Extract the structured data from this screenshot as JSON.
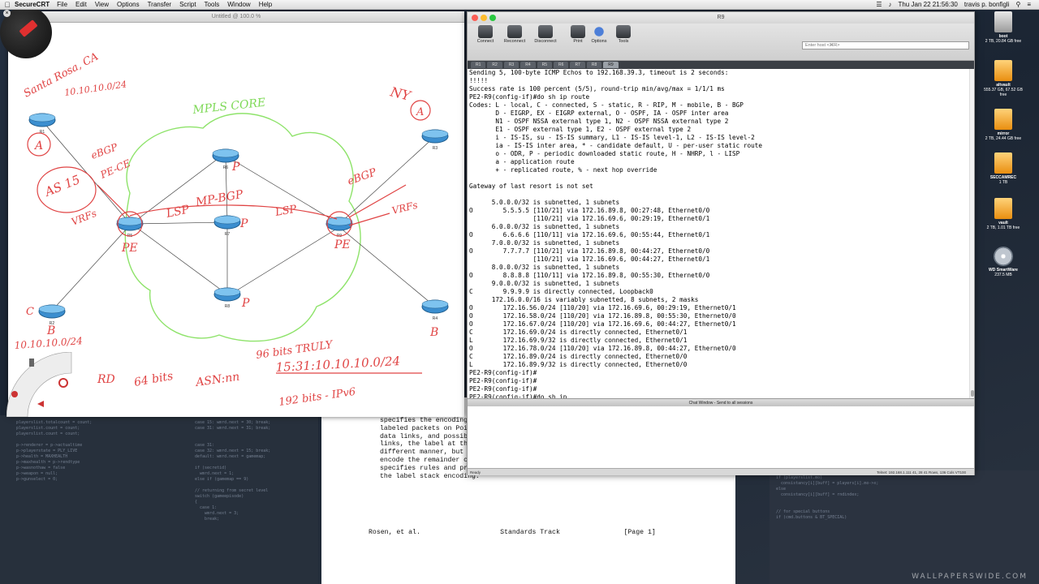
{
  "menubar": {
    "app_name": "SecureCRT",
    "items": [
      "File",
      "Edit",
      "View",
      "Options",
      "Transfer",
      "Script",
      "Tools",
      "Window",
      "Help"
    ],
    "clock": "Thu Jan 22  21:56:30",
    "user": "travis p. bonfigli"
  },
  "desktop": {
    "drives": [
      {
        "name": "boot",
        "size": "2 TB, 20.84 GB free",
        "icon": "hard-drive-icon"
      },
      {
        "name": "altvault",
        "size": "555.37 GB, 67.52 GB free",
        "icon": "hard-drive-icon"
      },
      {
        "name": "mirror",
        "size": "2 TB, 24.44 GB free",
        "icon": "hard-drive-icon"
      },
      {
        "name": "SECCAMREC",
        "size": "1 TB",
        "icon": "hard-drive-icon"
      },
      {
        "name": "vault",
        "size": "2 TB, 1.01 TB free",
        "icon": "hard-drive-icon"
      },
      {
        "name": "WD SmartWare",
        "size": "237.5 MB",
        "icon": "disc-icon"
      }
    ],
    "watermark": "WALLPAPERSWIDE.COM"
  },
  "whiteboard": {
    "title": "Untitled @ 100.0 %",
    "routers": [
      {
        "label": "R1"
      },
      {
        "label": "R2"
      },
      {
        "label": "R3"
      },
      {
        "label": "R4"
      },
      {
        "label": "R5"
      },
      {
        "label": "R6"
      },
      {
        "label": "R7"
      },
      {
        "label": "R8"
      },
      {
        "label": "R9"
      }
    ],
    "annotations": {
      "site_a": "Santa Rosa, CA",
      "prefix_a": "10.10.10.0/24",
      "mark_a": "A",
      "ebgp_left": "eBGP",
      "pe_ce": "PE-CE",
      "as": "AS 15",
      "vrfs_left": "VRFs",
      "pe_left": "PE",
      "mpls_core": "MPLS CORE",
      "lsp_left": "LSP",
      "mp_bgp": "MP-BGP",
      "lsp_right": "LSP",
      "p_top": "P",
      "p_mid": "P",
      "p_bottom": "P",
      "site_ny": "NY",
      "mark_a_right": "A",
      "ebgp_right": "eBGP",
      "vrfs_right": "VRFs",
      "pe_right": "PE",
      "mark_b_left": "B",
      "prefix_b": "10.10.10.0/24",
      "mark_c": "C",
      "mark_b_right": "B",
      "rd": "RD",
      "bits_64": "64 bits",
      "asn": "ASN:nn",
      "bits_96": "96 bits TRULY",
      "rd_example": "15:31:10.10.10.0/24",
      "ipv6": "192 bits - IPv6"
    }
  },
  "crt": {
    "window_title": "R9",
    "toolbar": [
      {
        "label": "Connect",
        "icon": "connect-icon"
      },
      {
        "label": "Reconnect",
        "icon": "reconnect-icon"
      },
      {
        "label": "Disconnect",
        "icon": "disconnect-icon"
      },
      {
        "label": "Print",
        "icon": "print-icon"
      },
      {
        "label": "Options",
        "icon": "options-icon"
      },
      {
        "label": "Tools",
        "icon": "tools-icon"
      }
    ],
    "host_placeholder": "Enter host <⌘R>",
    "tabs": [
      "R1",
      "R2",
      "R3",
      "R4",
      "R5",
      "R6",
      "R7",
      "R8",
      "R9"
    ],
    "active_tab": "R9",
    "terminal_lines": [
      "Sending 5, 100-byte ICMP Echos to 192.168.39.3, timeout is 2 seconds:",
      "!!!!!",
      "Success rate is 100 percent (5/5), round-trip min/avg/max = 1/1/1 ms",
      "PE2-R9(config-if)#do sh ip route",
      "Codes: L - local, C - connected, S - static, R - RIP, M - mobile, B - BGP",
      "       D - EIGRP, EX - EIGRP external, O - OSPF, IA - OSPF inter area",
      "       N1 - OSPF NSSA external type 1, N2 - OSPF NSSA external type 2",
      "       E1 - OSPF external type 1, E2 - OSPF external type 2",
      "       i - IS-IS, su - IS-IS summary, L1 - IS-IS level-1, L2 - IS-IS level-2",
      "       ia - IS-IS inter area, * - candidate default, U - per-user static route",
      "       o - ODR, P - periodic downloaded static route, H - NHRP, l - LISP",
      "       a - application route",
      "       + - replicated route, % - next hop override",
      "",
      "Gateway of last resort is not set",
      "",
      "      5.0.0.0/32 is subnetted, 1 subnets",
      "O        5.5.5.5 [110/21] via 172.16.89.8, 00:27:48, Ethernet0/0",
      "                 [110/21] via 172.16.69.6, 00:29:19, Ethernet0/1",
      "      6.0.0.0/32 is subnetted, 1 subnets",
      "O        6.6.6.6 [110/11] via 172.16.69.6, 00:55:44, Ethernet0/1",
      "      7.0.0.0/32 is subnetted, 1 subnets",
      "O        7.7.7.7 [110/21] via 172.16.89.8, 00:44:27, Ethernet0/0",
      "                 [110/21] via 172.16.69.6, 00:44:27, Ethernet0/1",
      "      8.0.0.0/32 is subnetted, 1 subnets",
      "O        8.8.8.8 [110/11] via 172.16.89.8, 00:55:30, Ethernet0/0",
      "      9.0.0.0/32 is subnetted, 1 subnets",
      "C        9.9.9.9 is directly connected, Loopback0",
      "      172.16.0.0/16 is variably subnetted, 8 subnets, 2 masks",
      "O        172.16.56.0/24 [110/20] via 172.16.69.6, 00:29:19, Ethernet0/1",
      "O        172.16.58.0/24 [110/20] via 172.16.89.8, 00:55:30, Ethernet0/0",
      "O        172.16.67.0/24 [110/20] via 172.16.69.6, 00:44:27, Ethernet0/1",
      "C        172.16.69.0/24 is directly connected, Ethernet0/1",
      "L        172.16.69.9/32 is directly connected, Ethernet0/1",
      "O        172.16.78.0/24 [110/20] via 172.16.89.8, 00:44:27, Ethernet0/0",
      "C        172.16.89.0/24 is directly connected, Ethernet0/0",
      "L        172.16.89.9/32 is directly connected, Ethernet0/0",
      "PE2-R9(config-if)#",
      "PE2-R9(config-if)#",
      "PE2-R9(config-if)#",
      "PE2-R9(config-if)#do sh ip"
    ],
    "chat_title": "Chat Window - Send to all sessions",
    "status_left": "Ready",
    "status_right": "Telnet: 192.168.1.111   41, 28   41 Rows, 136 Cols   VT100"
  },
  "document": {
    "lines": [
      "specifies the encoding",
      "labeled packets on Poi",
      "data links, and possib",
      "links, the label at th",
      "different manner, but",
      "encode the remainder c",
      "specifies rules and pr",
      "the label stack encoding."
    ],
    "footer_left": "Rosen, et al.",
    "footer_mid": "Standards Track",
    "footer_right": "[Page 1]"
  }
}
